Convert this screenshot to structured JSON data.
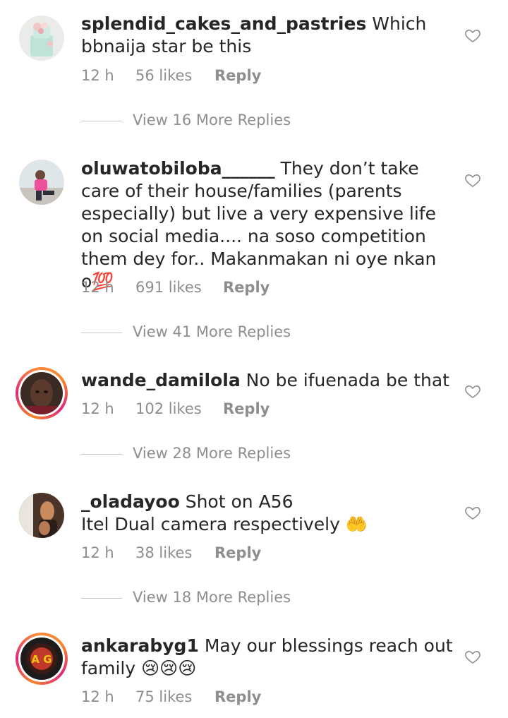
{
  "comments": [
    {
      "username": "splendid_cakes_and_pastries",
      "text": "Which bbnaija star be this",
      "time": "12 h",
      "likes": "56 likes",
      "reply": "Reply",
      "view_replies": "View 16 More Replies",
      "avatar": "cake-photo"
    },
    {
      "username": "oluwatobiloba______",
      "text": "They don’t take care of their house/families (parents especially) but live a very expensive life on social media.... na soso competition them dey for.. Makanmakan ni oye nkan o",
      "emoji": "💯",
      "time": "12 h",
      "likes": "691 likes",
      "reply": "Reply",
      "view_replies": "View 41 More Replies",
      "avatar": "person-pink-photo"
    },
    {
      "username": "wande_damilola",
      "text": "No be ifuenada be that",
      "time": "12 h",
      "likes": "102 likes",
      "reply": "Reply",
      "view_replies": "View 28 More Replies",
      "avatar": "selfie-photo"
    },
    {
      "username": "_oladayoo",
      "text": "Shot on A56\nItel Dual camera respectively",
      "emoji": "🤲",
      "time": "12 h",
      "likes": "38 likes",
      "reply": "Reply",
      "view_replies": "View 18 More Replies",
      "avatar": "person-photo"
    },
    {
      "username": "ankarabyg1",
      "text": "May our blessings reach out family",
      "emoji": "😢😢😢",
      "time": "12 h",
      "likes": "75 likes",
      "reply": "Reply",
      "avatar": "brand-logo",
      "logo_text": "A G"
    }
  ],
  "colors": {
    "text": "#262626",
    "muted": "#8e8e8e",
    "story_ring": "#dd2a7b"
  }
}
